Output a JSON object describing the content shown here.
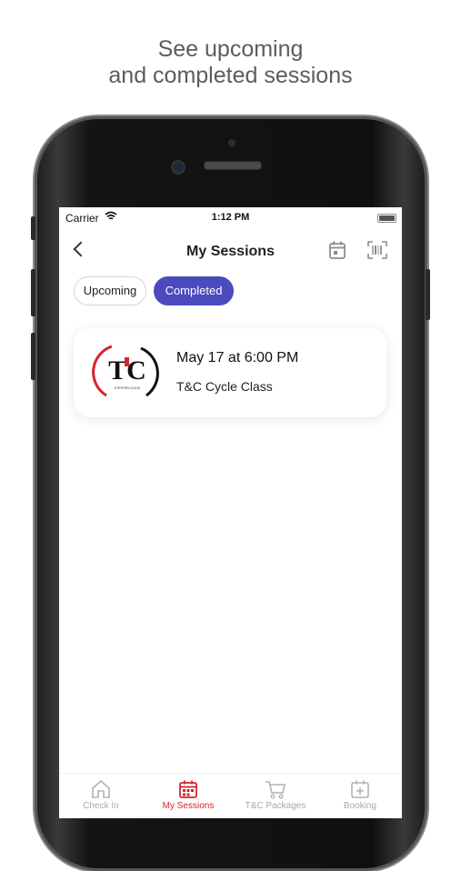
{
  "promo": {
    "line1": "See upcoming",
    "line2": "and completed sessions"
  },
  "status_bar": {
    "carrier": "Carrier",
    "time": "1:12 PM",
    "wifi_icon": "wifi-icon",
    "battery_icon": "battery-icon"
  },
  "header": {
    "title": "My Sessions",
    "back_icon": "chevron-left-icon",
    "actions": [
      "calendar-icon",
      "barcode-scan-icon"
    ]
  },
  "filter_tabs": {
    "upcoming": "Upcoming",
    "completed": "Completed",
    "selected": "Completed",
    "accent_color": "#4b4bbf"
  },
  "sessions": [
    {
      "datetime": "May 17 at 6:00 PM",
      "class_name": "T&C Cycle Class",
      "logo_text": "TC",
      "logo_subtext": "STEPHEN COOK"
    }
  ],
  "tab_bar": {
    "active_color": "#d8232a",
    "items": [
      {
        "label": "Check In",
        "icon": "home-icon"
      },
      {
        "label": "My Sessions",
        "icon": "calendar-icon"
      },
      {
        "label": "T&C Packages",
        "icon": "cart-icon"
      },
      {
        "label": "Booking",
        "icon": "calendar-plus-icon"
      }
    ],
    "active": "My Sessions"
  }
}
